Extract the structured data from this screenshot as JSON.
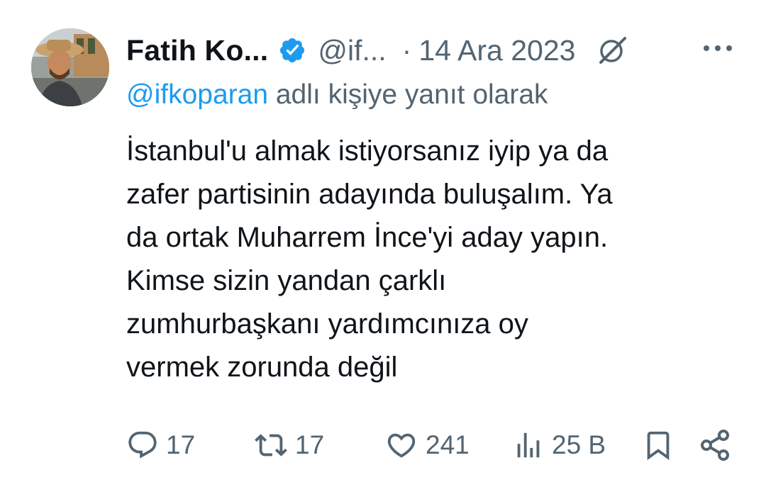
{
  "author": {
    "display_name": "Fatih Ko...",
    "handle": "@if...",
    "separator": "·",
    "date": "14 Ara 2023"
  },
  "reply": {
    "mention": "@ifkoparan",
    "text": " adlı kişiye yanıt olarak"
  },
  "tweet": {
    "lines": [
      "İstanbul'u almak istiyorsanız iyip ya da",
      "zafer partisinin adayında buluşalım. Ya",
      "da ortak Muharrem İnce'yi aday yapın.",
      "Kimse sizin yandan çarklı",
      "zumhurbaşkanı yardımcınıza oy",
      "vermek zorunda değil"
    ]
  },
  "actions": {
    "replies": "17",
    "reposts": "17",
    "likes": "241",
    "views": "25 B"
  },
  "colors": {
    "text": "#0f1419",
    "secondary": "#536471",
    "link": "#1d9bf0",
    "verified": "#1d9bf0"
  },
  "icons": {
    "verified": "verified-badge-icon",
    "grok": "grok-icon",
    "more": "more-dots-icon",
    "reply": "reply-bubble-icon",
    "repost": "repost-arrows-icon",
    "like": "heart-icon",
    "views": "views-bars-icon",
    "bookmark": "bookmark-icon",
    "share": "share-icon"
  }
}
